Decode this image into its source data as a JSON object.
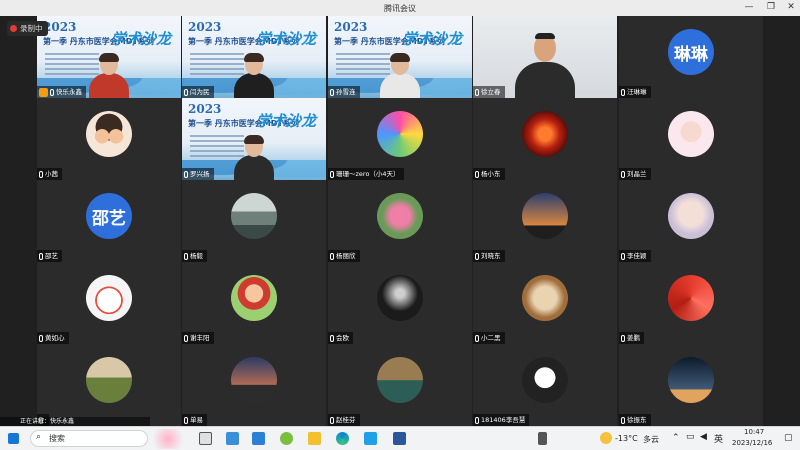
{
  "window": {
    "title": "腾讯会议"
  },
  "recording": {
    "label": "录制中"
  },
  "slide": {
    "year": "2023",
    "series": "第一季 丹东市医学会MDT系列",
    "big": "学术沙龙"
  },
  "participants": [
    {
      "name": "快乐永鑫",
      "type": "video",
      "host": true,
      "active": true,
      "shirt": "#c0392b"
    },
    {
      "name": "闫为民",
      "type": "video",
      "shirt": "#1f1f1f"
    },
    {
      "name": "孙雪连",
      "type": "video",
      "shirt": "#e8e8e8"
    },
    {
      "name": "徐立春",
      "type": "cam",
      "shirt": "#2b2b2b"
    },
    {
      "name": "汪琳琳",
      "type": "text",
      "avatar_text": "琳琳"
    },
    {
      "name": "小茜",
      "type": "img",
      "img": "kids"
    },
    {
      "name": "罗兴扬",
      "type": "video",
      "shirt": "#2b2b2b"
    },
    {
      "name": "珊珊～zero（小4天）",
      "type": "img",
      "img": "colorful"
    },
    {
      "name": "杨小东",
      "type": "img",
      "img": "red"
    },
    {
      "name": "刘晶兰",
      "type": "img",
      "img": "cartoon"
    },
    {
      "name": "邵艺",
      "type": "text",
      "avatar_text": "邵艺"
    },
    {
      "name": "杨毅",
      "type": "img",
      "img": "town"
    },
    {
      "name": "杨丽欣",
      "type": "img",
      "img": "flower"
    },
    {
      "name": "刘晓东",
      "type": "img",
      "img": "sunset"
    },
    {
      "name": "李佳颖",
      "type": "img",
      "img": "girl"
    },
    {
      "name": "黄如心",
      "type": "img",
      "img": "comic"
    },
    {
      "name": "谢丰阳",
      "type": "img",
      "img": "boy"
    },
    {
      "name": "会欧",
      "type": "img",
      "img": "bw"
    },
    {
      "name": "小二黑",
      "type": "img",
      "img": "family"
    },
    {
      "name": "姜鹏",
      "type": "img",
      "img": "redflower"
    },
    {
      "name": "",
      "type": "img",
      "img": "road"
    },
    {
      "name": "单易",
      "type": "img",
      "img": "dusk"
    },
    {
      "name": "赵桂芬",
      "type": "img",
      "img": "lake"
    },
    {
      "name": "181406李吾慧",
      "type": "img",
      "img": "manga"
    },
    {
      "name": "徐振东",
      "type": "img",
      "img": "night"
    }
  ],
  "notice": "正在讲解：快乐永鑫",
  "taskbar": {
    "search_placeholder": "搜索",
    "temp": "-13°C",
    "weather": "多云",
    "time": "10:47",
    "date": "2023/12/16"
  }
}
